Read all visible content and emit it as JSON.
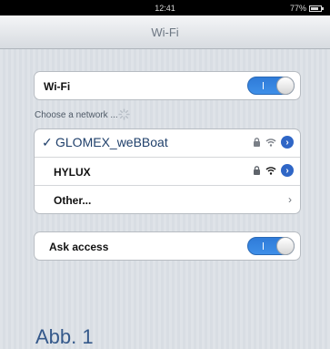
{
  "status_bar": {
    "time": "12:41",
    "battery_text": "77%",
    "battery_level": 0.77
  },
  "nav": {
    "title": "Wi-Fi"
  },
  "wifi_row": {
    "label": "Wi-Fi",
    "toggle_on": true
  },
  "section": {
    "choose_network": "Choose a network ..."
  },
  "networks": [
    {
      "name": "GLOMEX_weBBoat",
      "selected": true,
      "locked": true,
      "signal": "wifi-icon"
    },
    {
      "name": "HYLUX",
      "selected": false,
      "locked": true,
      "signal": "wifi-icon"
    }
  ],
  "other_row": {
    "label": "Other..."
  },
  "ask_access": {
    "label": "Ask access",
    "toggle_on": true
  },
  "figure_caption": "Abb. 1",
  "colors": {
    "accent": "#3e8fe8",
    "selected_text": "#20406b",
    "info_button": "#2f66c6"
  },
  "icons": {
    "check": "✓",
    "lock": "lock-icon",
    "info": "info-icon",
    "chevron": "chevron-right-icon"
  }
}
